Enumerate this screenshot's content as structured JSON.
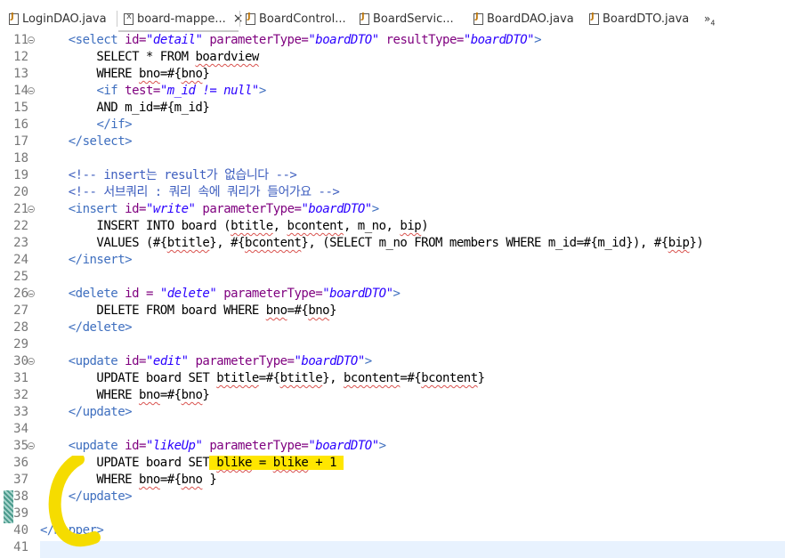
{
  "tabs": [
    {
      "label": "LoginDAO.java",
      "icon": "java-file-icon",
      "active": false
    },
    {
      "label": "board-mappe...",
      "icon": "xml-file-icon",
      "active": true
    },
    {
      "label": "BoardControl...",
      "icon": "java-file-icon",
      "active": false
    },
    {
      "label": "BoardServic...",
      "icon": "java-file-icon",
      "active": false
    },
    {
      "label": "BoardDAO.java",
      "icon": "java-file-icon",
      "active": false
    },
    {
      "label": "BoardDTO.java",
      "icon": "java-file-icon",
      "active": false
    }
  ],
  "tab_close_glyph": "×",
  "overflow": {
    "glyph": "»",
    "count": "4"
  },
  "editor": {
    "lines": [
      {
        "n": "11",
        "html": "    <span class='tag'>&lt;select</span> <span class='attr'>id=</span><span class='val'>\"detail\"</span> <span class='attr'>parameterType=</span><span class='val'>\"boardDTO\"</span> <span class='attr'>resultType=</span><span class='val'>\"boardDTO\"</span><span class='tag'>&gt;</span>",
        "fold": true
      },
      {
        "n": "12",
        "html": "        SELECT * FROM <span class='sq'>boardview</span>",
        "fold": false
      },
      {
        "n": "13",
        "html": "        WHERE <span class='sq'>bno</span>=#{<span class='sq'>bno</span>}",
        "fold": false
      },
      {
        "n": "14",
        "html": "        <span class='tag'>&lt;if</span> <span class='attr'>test=</span><span class='val'>\"m_id != null\"</span><span class='tag'>&gt;</span>",
        "fold": true
      },
      {
        "n": "15",
        "html": "        AND m_id=#{m_id}",
        "fold": false
      },
      {
        "n": "16",
        "html": "        <span class='tag'>&lt;/if&gt;</span>",
        "fold": false
      },
      {
        "n": "17",
        "html": "    <span class='tag'>&lt;/select&gt;</span>",
        "fold": false
      },
      {
        "n": "18",
        "html": "",
        "fold": false
      },
      {
        "n": "19",
        "html": "    <span class='cmt'>&lt;!-- insert는 result가 없습니다 --&gt;</span>",
        "fold": false
      },
      {
        "n": "20",
        "html": "    <span class='cmt'>&lt;!-- 서브쿼리 : 쿼리 속에 쿼리가 들어가요 --&gt;</span>",
        "fold": false
      },
      {
        "n": "21",
        "html": "    <span class='tag'>&lt;insert</span> <span class='attr'>id=</span><span class='val'>\"write\"</span> <span class='attr'>parameterType=</span><span class='val'>\"boardDTO\"</span><span class='tag'>&gt;</span>",
        "fold": true
      },
      {
        "n": "22",
        "html": "        INSERT INTO board (<span class='sq'>btitle</span>, <span class='sq'>bcontent</span>, m_no, <span class='sq'>bip</span>)",
        "fold": false
      },
      {
        "n": "23",
        "html": "        VALUES (#{<span class='sq'>btitle</span>}, #{<span class='sq'>bcontent</span>}, (SELECT m_no FROM members WHERE m_id=#{m_id}), #{<span class='sq'>bip</span>})",
        "fold": false
      },
      {
        "n": "24",
        "html": "    <span class='tag'>&lt;/insert&gt;</span>",
        "fold": false
      },
      {
        "n": "25",
        "html": "",
        "fold": false
      },
      {
        "n": "26",
        "html": "    <span class='tag'>&lt;delete</span> <span class='attr'>id =</span> <span class='val'>\"delete\"</span> <span class='attr'>parameterType=</span><span class='val'>\"boardDTO\"</span><span class='tag'>&gt;</span>",
        "fold": true
      },
      {
        "n": "27",
        "html": "        DELETE FROM board WHERE <span class='sq'>bno</span>=#{<span class='sq'>bno</span>}",
        "fold": false
      },
      {
        "n": "28",
        "html": "    <span class='tag'>&lt;/delete&gt;</span>",
        "fold": false
      },
      {
        "n": "29",
        "html": "",
        "fold": false
      },
      {
        "n": "30",
        "html": "    <span class='tag'>&lt;update</span> <span class='attr'>id=</span><span class='val'>\"edit\"</span> <span class='attr'>parameterType=</span><span class='val'>\"boardDTO\"</span><span class='tag'>&gt;</span>",
        "fold": true
      },
      {
        "n": "31",
        "html": "        UPDATE board SET <span class='sq'>btitle</span>=#{<span class='sq'>btitle</span>}, <span class='sq'>bcontent</span>=#{<span class='sq'>bcontent</span>}",
        "fold": false
      },
      {
        "n": "32",
        "html": "        WHERE <span class='sq'>bno</span>=#{<span class='sq'>bno</span>}",
        "fold": false
      },
      {
        "n": "33",
        "html": "    <span class='tag'>&lt;/update&gt;</span>",
        "fold": false
      },
      {
        "n": "34",
        "html": "",
        "fold": false
      },
      {
        "n": "35",
        "html": "    <span class='tag'>&lt;update</span> <span class='attr'>id=</span><span class='val'>\"likeUp\"</span> <span class='attr'>parameterType=</span><span class='val'>\"boardDTO\"</span><span class='tag'>&gt;</span>",
        "fold": true
      },
      {
        "n": "36",
        "html": "        UPDATE board SET<span class='hl'> <span class='sq'>blike</span> = <span class='sq'>blike</span> + 1 </span>",
        "fold": false
      },
      {
        "n": "37",
        "html": "        WHERE <span class='sq'>bno</span>=#{<span class='sq'>bno</span> }",
        "fold": false
      },
      {
        "n": "38",
        "html": "    <span class='tag'>&lt;/update&gt;</span>",
        "fold": false
      },
      {
        "n": "39",
        "html": "",
        "fold": false
      },
      {
        "n": "40",
        "html": "<span class='tag'>&lt;/mapper&gt;</span>",
        "fold": false
      },
      {
        "n": "41",
        "html": "",
        "fold": false
      }
    ]
  },
  "colors": {
    "tag": "#3f6fbf",
    "attr": "#7f007f",
    "value": "#2a00ff",
    "comment": "#3f5fbf",
    "highlight": "#ffe600",
    "annotation": "#f5dc00"
  }
}
